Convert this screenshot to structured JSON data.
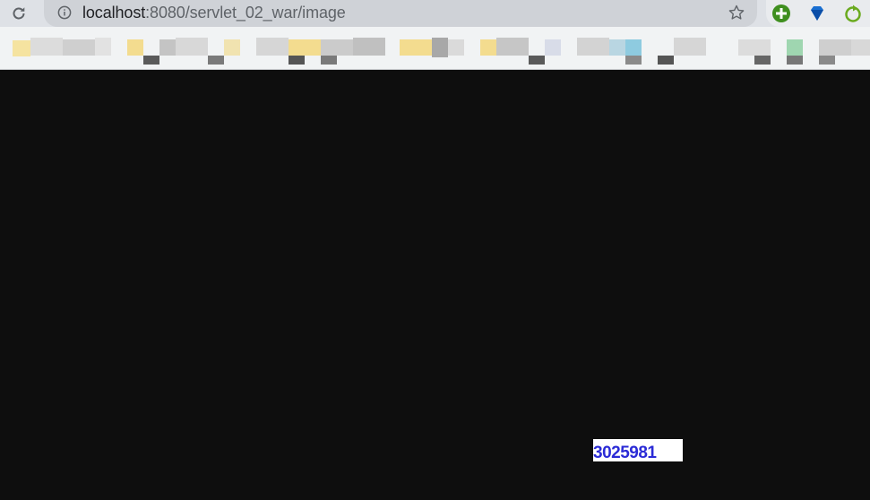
{
  "browser": {
    "address_host": "localhost",
    "address_rest": ":8080/servlet_02_war/image",
    "icons": {
      "reload": "reload-icon",
      "info": "info-icon",
      "star": "bookmark-star-icon",
      "extensions": [
        "green-plus-extension-icon",
        "blue-diamond-extension-icon",
        "green-refresh-extension-icon"
      ]
    },
    "colors": {
      "toolbar_bg": "#dee1e6",
      "omnibox_bg": "#cfd2d7",
      "bookmarks_bg": "#f1f3f4"
    }
  },
  "page": {
    "background": "#0e0e0e",
    "verification_code": "3025981",
    "code_color": "#2b2bd6"
  }
}
